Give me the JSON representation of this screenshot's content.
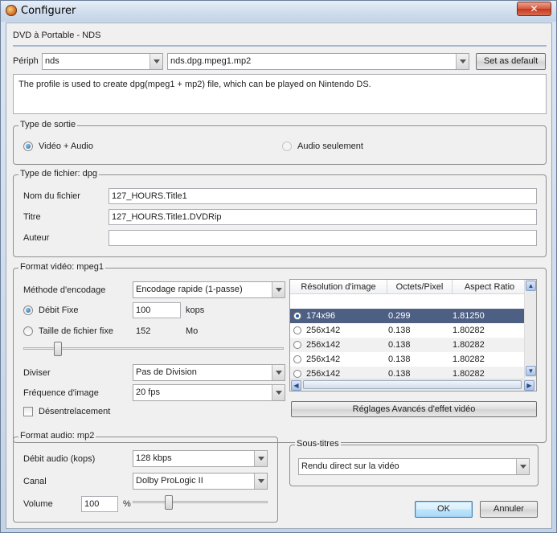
{
  "window": {
    "title": "Configurer",
    "close_label": "✕"
  },
  "profile_name": "DVD à Portable - NDS",
  "periph": {
    "label": "Périph",
    "device": "nds",
    "profile": "nds.dpg.mpeg1.mp2",
    "set_default_label": "Set as default"
  },
  "description": "The profile is used to create dpg(mpeg1 + mp2) file, which can be played on Nintendo DS.",
  "output_type": {
    "legend": "Type de sortie",
    "video_audio": "Vidéo + Audio",
    "audio_only": "Audio seulement",
    "selected": "video_audio"
  },
  "file_type": {
    "legend": "Type de fichier: dpg",
    "filename_label": "Nom du fichier",
    "filename": "127_HOURS.Title1",
    "title_label": "Titre",
    "title": "127_HOURS.Title1.DVDRip",
    "author_label": "Auteur",
    "author": ""
  },
  "video": {
    "legend": "Format vidéo: mpeg1",
    "method_label": "Méthode d'encodage",
    "method": "Encodage rapide (1-passe)",
    "fixed_bitrate_label": "Débit Fixe",
    "fixed_bitrate": "100",
    "bitrate_unit": "kops",
    "fixed_size_label": "Taille de fichier fixe",
    "fixed_size": "152",
    "size_unit": "Mo",
    "split_label": "Diviser",
    "split": "Pas de Division",
    "fps_label": "Fréquence d'image",
    "fps": "20 fps",
    "deinterlace_label": "Désentrelacement",
    "deinterlace_checked": false,
    "quality_slider_fraction": 0.12,
    "resolution_table": {
      "columns": [
        "Résolution d'image",
        "Octets/Pixel",
        "Aspect Ratio"
      ],
      "rows": [
        {
          "resolution": "174x96",
          "bpp": "0.299",
          "ratio": "1.81250",
          "selected": true
        },
        {
          "resolution": "256x142",
          "bpp": "0.138",
          "ratio": "1.80282",
          "selected": false
        },
        {
          "resolution": "256x142",
          "bpp": "0.138",
          "ratio": "1.80282",
          "selected": false
        },
        {
          "resolution": "256x142",
          "bpp": "0.138",
          "ratio": "1.80282",
          "selected": false
        },
        {
          "resolution": "256x142",
          "bpp": "0.138",
          "ratio": "1.80282",
          "selected": false
        }
      ]
    },
    "advanced_label": "Réglages Avancés d'effet vidéo"
  },
  "audio": {
    "legend": "Format audio: mp2",
    "bitrate_label": "Débit audio (kops)",
    "bitrate": "128 kbps",
    "channel_label": "Canal",
    "channel": "Dolby ProLogic II",
    "volume_label": "Volume",
    "volume": "100",
    "volume_unit": "%",
    "volume_slider_fraction": 0.25
  },
  "subtitles": {
    "legend": "Sous-titres",
    "mode": "Rendu direct sur la vidéo"
  },
  "buttons": {
    "ok": "OK",
    "cancel": "Annuler"
  }
}
